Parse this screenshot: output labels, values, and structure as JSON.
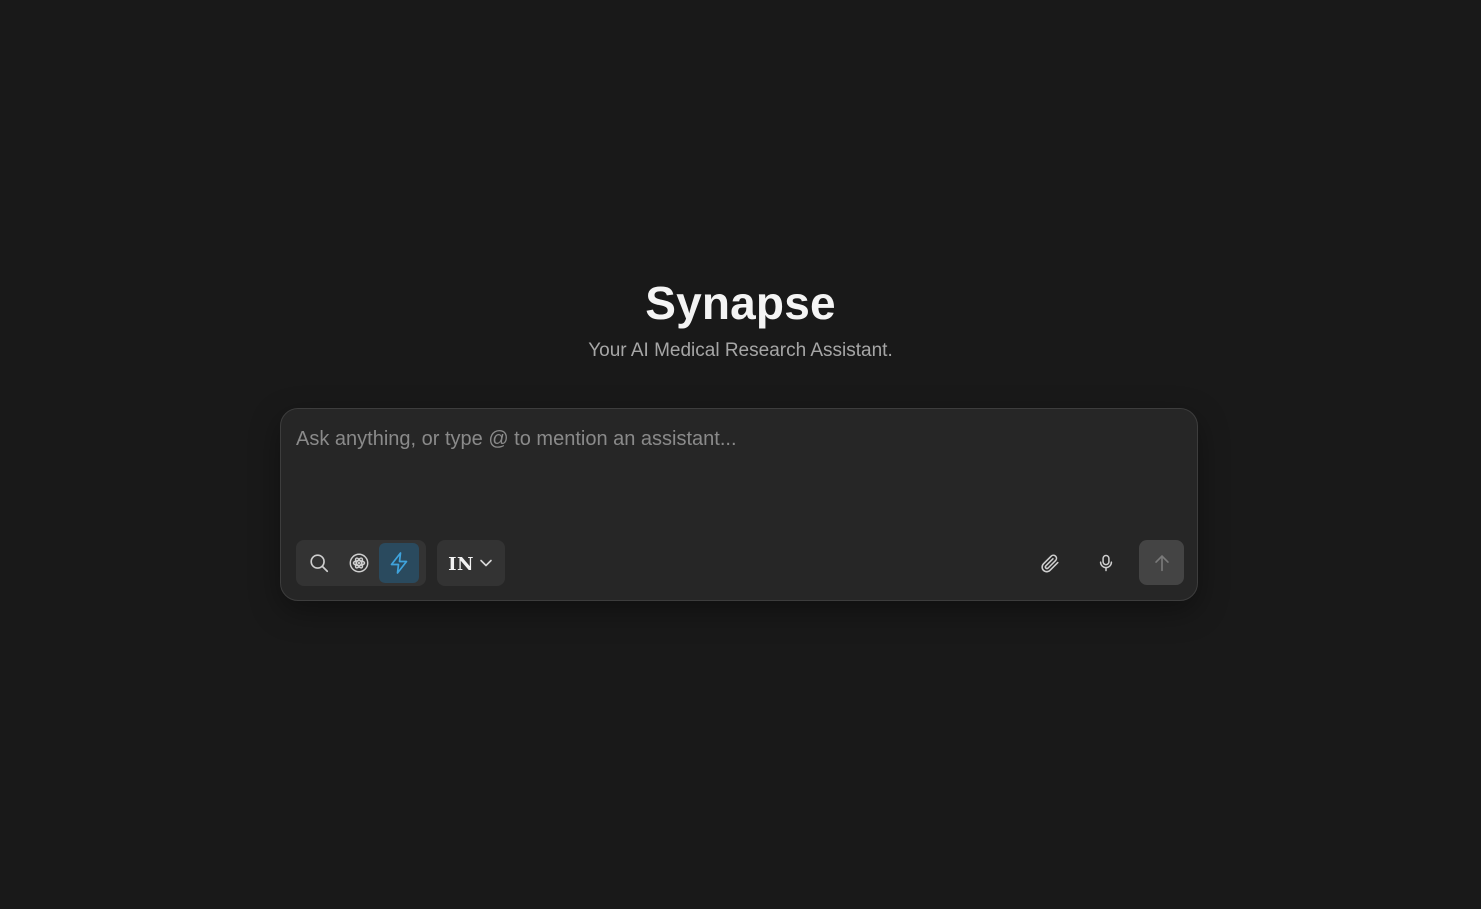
{
  "app": {
    "title": "Synapse",
    "subtitle": "Your AI Medical Research Assistant."
  },
  "composer": {
    "placeholder": "Ask anything, or type @ to mention an assistant...",
    "value": "",
    "modes": [
      {
        "name": "search",
        "icon": "search-icon",
        "active": false
      },
      {
        "name": "research",
        "icon": "atom-icon",
        "active": false
      },
      {
        "name": "quick",
        "icon": "lightning-icon",
        "active": true
      }
    ],
    "language": {
      "selected": "IN",
      "icon": "chevron-down-icon"
    },
    "actions": {
      "attach_icon": "paperclip-icon",
      "mic_icon": "microphone-icon",
      "send_icon": "arrow-up-icon"
    }
  },
  "colors": {
    "background": "#191919",
    "composer_bg": "#262626",
    "active_mode_bg": "#2a4a5e",
    "active_mode_icon": "#3fa3dc",
    "send_button_bg": "#444444"
  }
}
